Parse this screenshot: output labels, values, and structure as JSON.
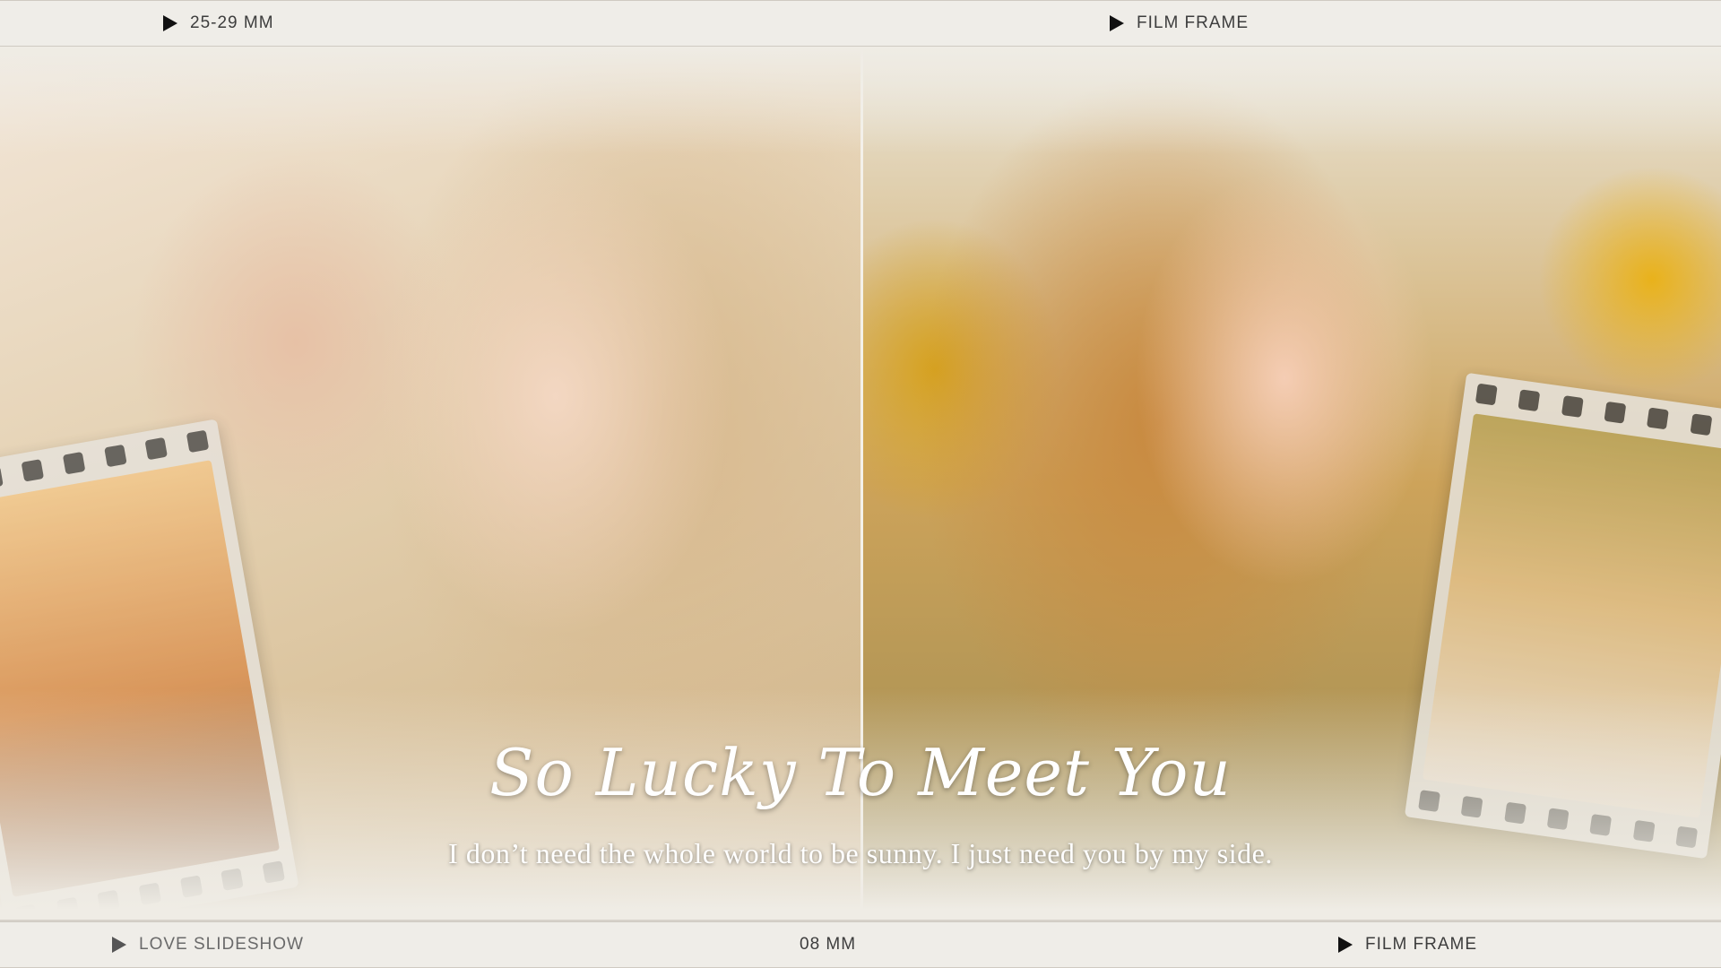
{
  "top_bar": {
    "left_label": "25-29 MM",
    "right_label": "FILM FRAME"
  },
  "bottom_bar": {
    "left_label": "LOVE SLIDESHOW",
    "center_label": "08 MM",
    "right_label": "FILM FRAME"
  },
  "main": {
    "title": "So Lucky To Meet You",
    "subtitle": "I don’t need the whole world to be sunny. I just need you by my side."
  },
  "icons": {
    "play": "play-triangle-icon"
  }
}
